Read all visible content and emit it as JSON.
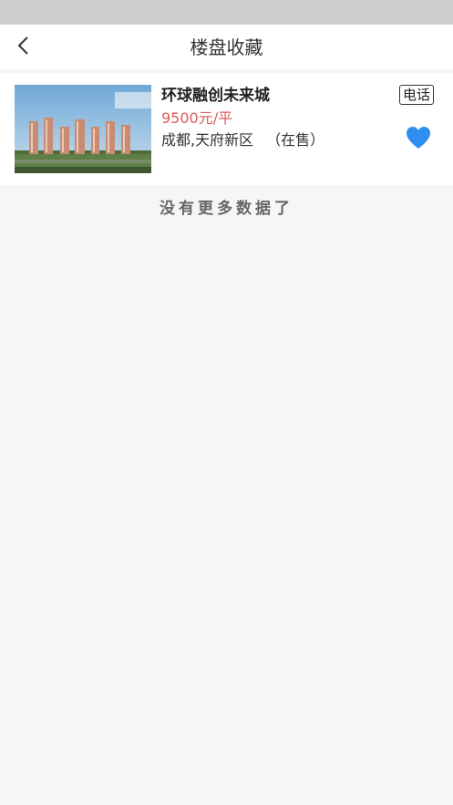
{
  "header": {
    "title": "楼盘收藏",
    "back_icon": "chevron-left-icon"
  },
  "favorites": [
    {
      "name": "环球融创未来城",
      "price": "9500元/平",
      "location": "成都,天府新区",
      "status": "（在售）",
      "phone_label": "电话",
      "favorite_icon": "heart-icon"
    }
  ],
  "list_end_text": "没有更多数据了",
  "colors": {
    "price": "#e05a5a",
    "heart": "#2f8fee",
    "status_bar": "#cfcfcf",
    "background": "#f6f6f6"
  }
}
